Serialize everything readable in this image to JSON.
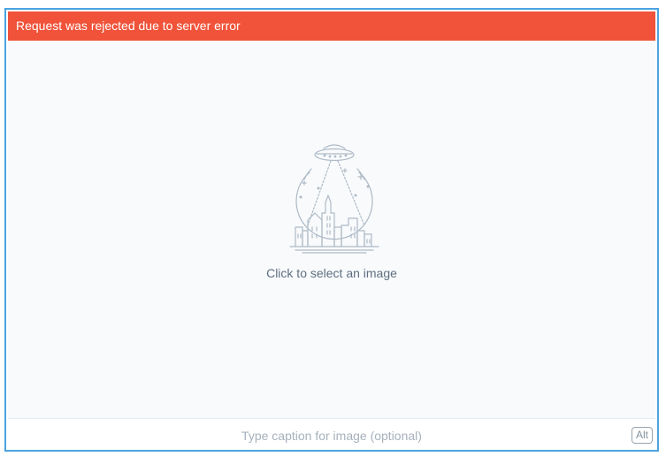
{
  "error_banner": {
    "message": "Request was rejected due to server error",
    "color": "#f0533a"
  },
  "upload": {
    "prompt": "Click to select an image",
    "illustration_icon": "ufo-city-globe-icon"
  },
  "caption": {
    "placeholder": "Type caption for image (optional)",
    "value": ""
  },
  "alt_button": {
    "label": "Alt"
  },
  "colors": {
    "accent_border": "#4aa3e0",
    "error": "#f0533a",
    "area_background": "#f8fafc"
  }
}
